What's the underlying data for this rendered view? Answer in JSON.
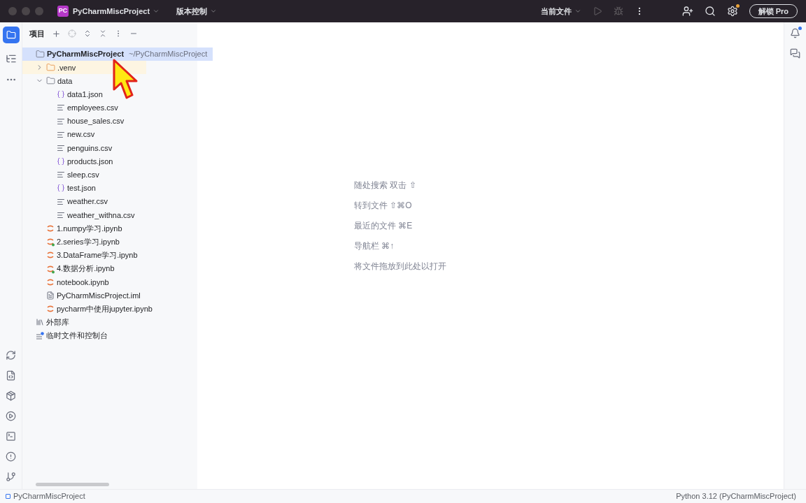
{
  "title_bar": {
    "logo": "PC",
    "project": "PyCharmMiscProject",
    "vcs": "版本控制",
    "run_config": "当前文件",
    "upgrade_button": "解锁 Pro",
    "settings_badge": true
  },
  "project_panel": {
    "title": "项目",
    "tree": [
      {
        "kind": "folder",
        "label": "PyCharmMiscProject",
        "path": "~/PyCharmMiscProject",
        "selected": true,
        "children": [
          {
            "kind": "folder",
            "label": ".venv",
            "selected": false,
            "expanded": false,
            "excluded": true
          },
          {
            "kind": "folder",
            "label": "data",
            "selected": false,
            "expanded": true,
            "children": [
              {
                "kind": "json",
                "label": "data1.json",
                "selected": false
              },
              {
                "kind": "csv",
                "label": "employees.csv",
                "selected": false
              },
              {
                "kind": "csv",
                "label": "house_sales.csv",
                "selected": false
              },
              {
                "kind": "csv",
                "label": "new.csv",
                "selected": false
              },
              {
                "kind": "csv",
                "label": "penguins.csv",
                "selected": false
              },
              {
                "kind": "json",
                "label": "products.json",
                "selected": false
              },
              {
                "kind": "csv",
                "label": "sleep.csv",
                "selected": false
              },
              {
                "kind": "json",
                "label": "test.json",
                "selected": false
              },
              {
                "kind": "csv",
                "label": "weather.csv",
                "selected": false
              },
              {
                "kind": "csv",
                "label": "weather_withna.csv",
                "selected": false
              }
            ]
          },
          {
            "kind": "notebook",
            "label": "1.numpy学习.ipynb",
            "selected": false,
            "marked": false
          },
          {
            "kind": "notebook",
            "label": "2.series学习.ipynb",
            "selected": false,
            "marked": true
          },
          {
            "kind": "notebook",
            "label": "3.DataFrame学习.ipynb",
            "selected": false,
            "marked": false
          },
          {
            "kind": "notebook",
            "label": "4.数据分析.ipynb",
            "selected": false,
            "marked": true
          },
          {
            "kind": "notebook",
            "label": "notebook.ipynb",
            "selected": false,
            "marked": false
          },
          {
            "kind": "iml",
            "label": "PyCharmMiscProject.iml",
            "selected": false
          },
          {
            "kind": "notebook",
            "label": "pycharm中使用jupyter.ipynb",
            "selected": false,
            "marked": false
          }
        ]
      },
      {
        "kind": "library",
        "label": "外部库",
        "selected": false
      },
      {
        "kind": "scratch",
        "label": "临时文件和控制台",
        "selected": false
      }
    ]
  },
  "editor_hints": [
    {
      "action": "随处搜索",
      "shortcut": "双击 ⇧"
    },
    {
      "action": "转到文件",
      "shortcut": "⇧⌘O"
    },
    {
      "action": "最近的文件",
      "shortcut": "⌘E"
    },
    {
      "action": "导航栏",
      "shortcut": "⌘↑"
    },
    {
      "action": "将文件拖放到此处以打开"
    }
  ],
  "notifications_badge": true,
  "status_bar": {
    "breadcrumb": "PyCharmMiscProject",
    "interpreter": "Python 3.12 (PyCharmMiscProject)"
  }
}
